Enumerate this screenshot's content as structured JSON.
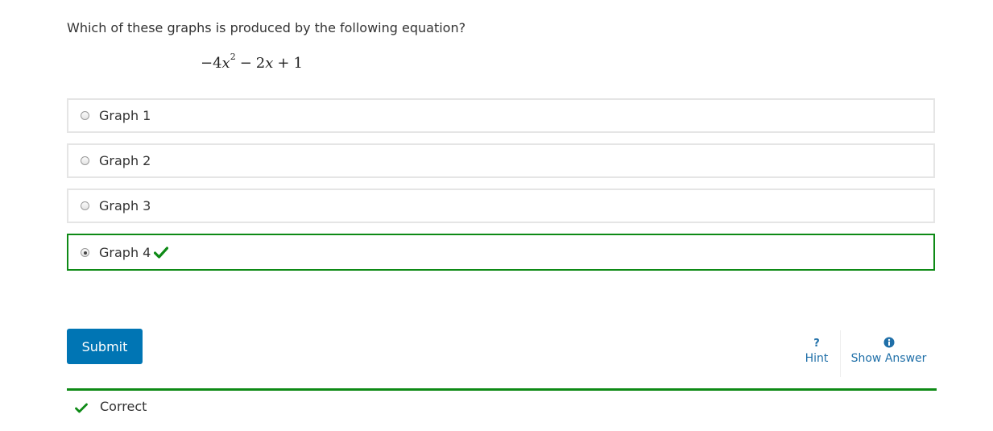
{
  "question": {
    "prompt": "Which of these graphs is produced by the following equation?",
    "equation": {
      "minus": "−",
      "coef1": "4",
      "var1": "x",
      "exp": "2",
      "op1": "−",
      "coef2": "2",
      "var2": "x",
      "op2": "+",
      "const": "1"
    }
  },
  "options": [
    {
      "label": "Graph 1",
      "selected": false,
      "correct": false
    },
    {
      "label": "Graph 2",
      "selected": false,
      "correct": false
    },
    {
      "label": "Graph 3",
      "selected": false,
      "correct": false
    },
    {
      "label": "Graph 4",
      "selected": true,
      "correct": true
    }
  ],
  "actions": {
    "submit_label": "Submit",
    "hint_label": "Hint",
    "hint_icon": "question-icon",
    "show_answer_label": "Show Answer",
    "show_answer_icon": "info-icon"
  },
  "status": {
    "text": "Correct",
    "icon": "check-icon",
    "color": "#0e8a16"
  },
  "colors": {
    "accent": "#0075b4",
    "correct": "#0e8a16",
    "link": "#1f6fa8"
  }
}
